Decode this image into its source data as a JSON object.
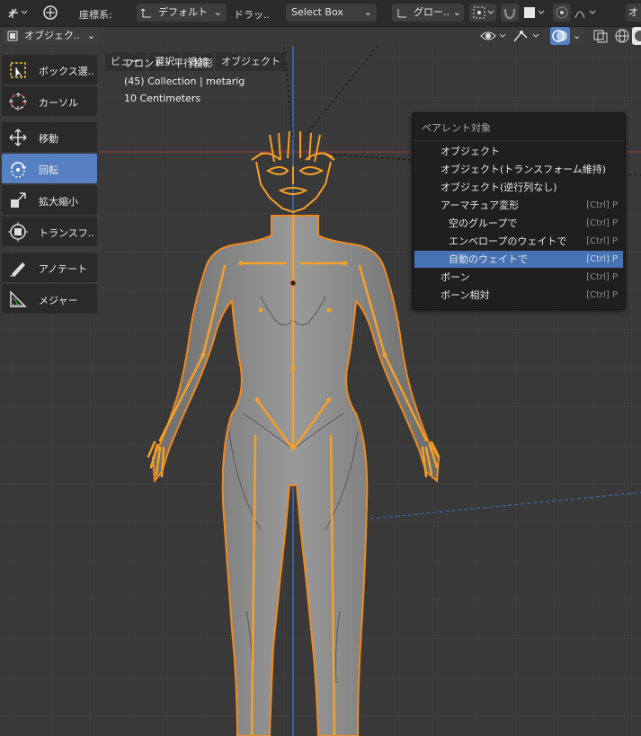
{
  "header": {
    "coord_label": "座標系:",
    "coord_value": "デフォルト",
    "drag_label": "ドラッ..",
    "select_mode": "Select Box",
    "transform_orient": "グロー..",
    "edge_char": "オ"
  },
  "menubar": {
    "mode": "オブジェク..",
    "items": [
      "ビュー",
      "選択",
      "追加",
      "オブジェクト"
    ]
  },
  "toolbar": {
    "tools": [
      {
        "label": "ボックス選..",
        "icon": "box-select-icon"
      },
      {
        "label": "カーソル",
        "icon": "cursor-icon"
      },
      {
        "label": "移動",
        "icon": "move-icon"
      },
      {
        "label": "回転",
        "icon": "rotate-icon"
      },
      {
        "label": "拡大縮小",
        "icon": "scale-icon"
      },
      {
        "label": "トランスフ..",
        "icon": "transform-icon"
      },
      {
        "label": "アノテート",
        "icon": "annotate-icon"
      },
      {
        "label": "メジャー",
        "icon": "measure-icon"
      }
    ],
    "active_tool": "回転"
  },
  "viewport": {
    "view_name": "フロント・平行投影",
    "collection": "(45) Collection | metarig",
    "scale": "10 Centimeters"
  },
  "parent_menu": {
    "title": "ペアレント対象",
    "items": [
      {
        "label": "オブジェクト",
        "shortcut": ""
      },
      {
        "label": "オブジェクト(トランスフォーム維持)",
        "shortcut": ""
      },
      {
        "label": "オブジェクト(逆行列なし)",
        "shortcut": ""
      },
      {
        "label": "アーマチュア変形",
        "shortcut": "[Ctrl] P"
      },
      {
        "label": "空のグループで",
        "shortcut": "[Ctrl] P"
      },
      {
        "label": "エンベロープのウェイトで",
        "shortcut": "[Ctrl] P"
      },
      {
        "label": "自動のウェイトで",
        "shortcut": "[Ctrl] P"
      },
      {
        "label": "ボーン",
        "shortcut": "[Ctrl] P"
      },
      {
        "label": "ボーン相対",
        "shortcut": "[Ctrl] P"
      }
    ],
    "highlighted": "自動のウェイトで"
  },
  "colors": {
    "accent": "#5680c2",
    "menu_highlight": "#4772b3",
    "selection_orange": "#f5a028",
    "x_axis": "#b0404a",
    "z_axis": "#3c70c0"
  }
}
